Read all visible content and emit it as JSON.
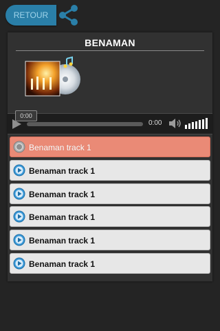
{
  "header": {
    "back_label": "RETOUR"
  },
  "album": {
    "title": "BENAMAN"
  },
  "player": {
    "tooltip_time": "0:00",
    "time": "0:00"
  },
  "tracks": [
    {
      "label": "Benaman track 1",
      "state": "playing"
    },
    {
      "label": "Benaman track 1",
      "state": "idle"
    },
    {
      "label": "Benaman track 1",
      "state": "idle"
    },
    {
      "label": "Benaman track 1",
      "state": "idle"
    },
    {
      "label": "Benaman track 1",
      "state": "idle"
    },
    {
      "label": "Benaman track 1",
      "state": "idle"
    }
  ],
  "icons": {
    "share": "share-icon",
    "play": "play-icon",
    "volume": "volume-icon",
    "track": "play-circle-icon"
  },
  "colors": {
    "accent": "#2a7fa8",
    "active_row": "#ea8a76",
    "row": "#e7e7e7",
    "icon_blue": "#3b9ad9"
  }
}
